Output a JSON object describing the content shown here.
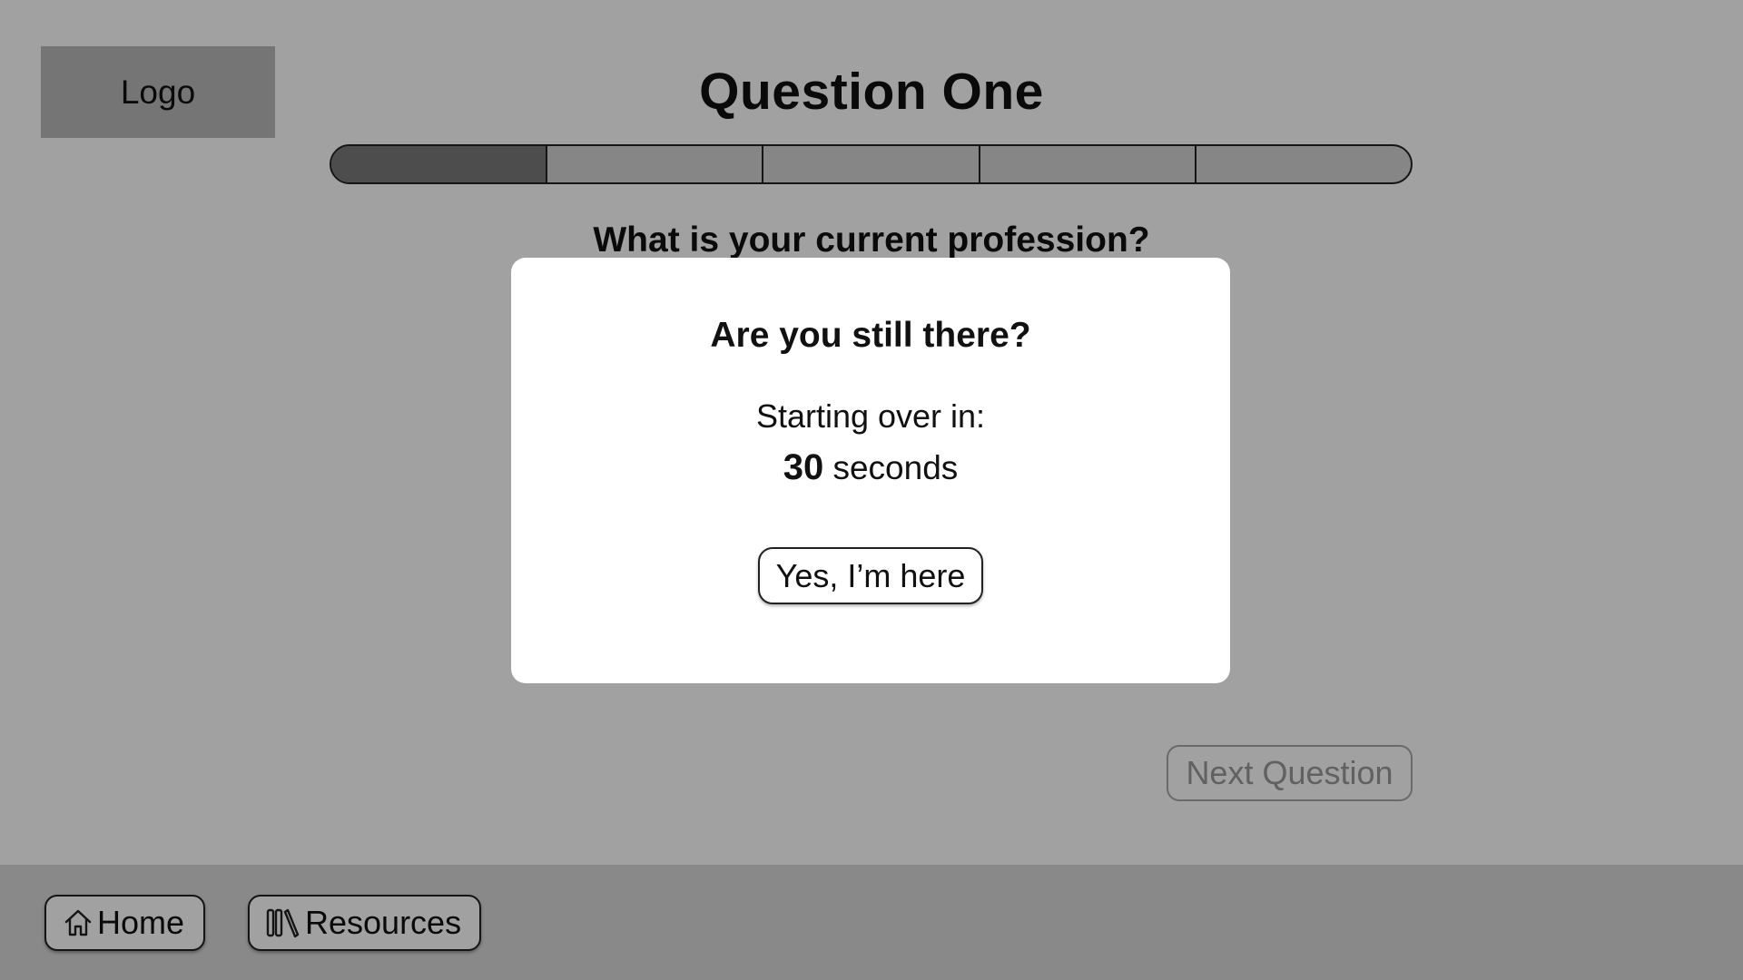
{
  "header": {
    "logo_label": "Logo",
    "title": "Question One"
  },
  "progress": {
    "total_steps": 5,
    "completed_steps": 1
  },
  "question": {
    "text": "What is your current profession?"
  },
  "navigation": {
    "next_label": "Next Question"
  },
  "footer": {
    "home_label": "Home",
    "home_icon": "home-icon",
    "resources_label": "Resources",
    "resources_icon": "books-icon"
  },
  "modal": {
    "title": "Are you still there?",
    "countdown_label": "Starting over in:",
    "countdown_value": "30",
    "countdown_unit": "seconds",
    "confirm_label": "Yes, I’m here"
  },
  "colors": {
    "overlay": "#000000",
    "progress_done": "#7c7a7b",
    "progress_todo": "#d4d4d4",
    "footer_bg": "#d9d9d9",
    "logo_bg": "#b9b9b9"
  }
}
